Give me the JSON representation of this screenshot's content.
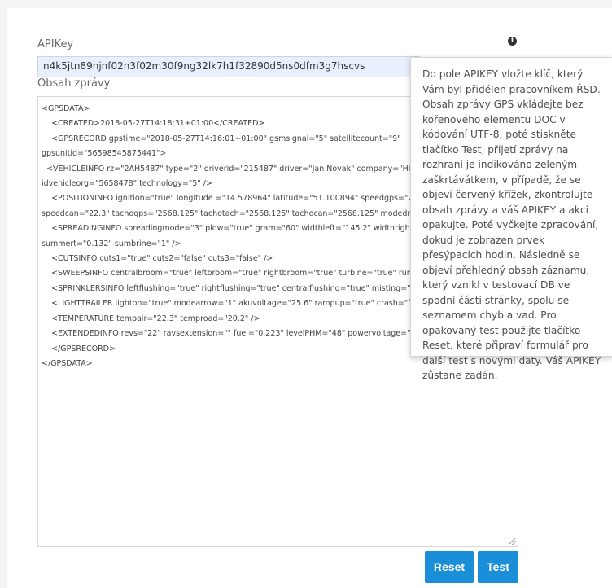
{
  "form": {
    "apikey_label": "APIKey",
    "apikey_value": "n4k5jtn89njnf02n3f02m30f9ng32lk7h1f32890d5ns0dfm3g7hscvs",
    "message_label": "Obsah zprávy",
    "message_lines": [
      "<GPSDATA>",
      "    <CREATED>2018-05-27T14:18:31+01:00</CREATED>",
      "    <GPSRECORD gpstime=\"2018-05-27T14:16:01+01:00\" gsmsignal=\"5\" satellitecount=\"9\"",
      "gpsunitid=\"56598545875441\">",
      "  <VEHICLEINFO rz=\"2AH5487\" type=\"2\" driverid=\"215487\" driver=\"Jan Novak\" company=\"Hil",
      "idvehicleorg=\"5658478\" technology=\"5\" />",
      "    <POSITIONINFO ignition=\"true\" longitude =\"14.578964\" latitude=\"51.100894\" speedgps=\"2",
      "speedcan=\"22.3\" tachogps=\"2568.125\" tachotach=\"2568.125\" tachocan=\"2568.125\" modedriv",
      "    <SPREADINGINFO spreadingmode=\"3\" plow=\"true\" gram=\"60\" widthleft=\"145.2\" widthright",
      "summert=\"0.132\" sumbrine=\"1\" />",
      "    <CUTSINFO cuts1=\"true\" cuts2=\"false\" cuts3=\"false\" />",
      "    <SWEEPSINFO centralbroom=\"true\" leftbroom=\"true\" rightbroom=\"true\" turbine=\"true\" runni",
      "    <SPRINKLERSINFO leftflushing=\"true\" rightflushing=\"true\" centralflushing=\"true\" misting=\"",
      "    <LIGHTTRAILER lighton=\"true\" modearrow=\"1\" akuvoltage=\"25.6\" rampup=\"true\" crash=\"fals",
      "    <TEMPERATURE tempair=\"22.3\" temproad=\"20.2\" />",
      "    <EXTENDEDINFO revs=\"22\" ravsextension=\"\" fuel=\"0.223\" levelPHM=\"48\" powervoltage=\"",
      "    </GPSRECORD>",
      "</GPSDATA>"
    ]
  },
  "buttons": {
    "reset_label": "Reset",
    "test_label": "Test"
  },
  "info_icon_glyph": "i",
  "popover_text": "Do pole APIKEY vložte klíč, který Vám byl přidělen pracovníkem ŘSD. Obsah zprávy GPS vkládejte bez kořenového elementu DOC v kódování UTF-8, poté stiskněte tlačítko Test, přijetí zprávy na rozhraní je indikováno zeleným zaškrtávátkem, v případě, že se objeví červený křížek, zkontrolujte obsah zprávy a váš APIKEY a akci opakujte. Poté vyčkejte zpracování, dokud je zobrazen prvek přesýpacích hodin. Následně se objeví přehledný obsah záznamu, který vznikl v testovací DB ve spodní části stránky, spolu se seznamem chyb a vad. Pro opakovaný test použijte tlačítko Reset, které připraví formulář pro další test s novými daty. Váš APIKEY zůstane zadán.",
  "colors": {
    "primary_button": "#1a8fd8",
    "input_autofill": "#e8f0fe"
  }
}
